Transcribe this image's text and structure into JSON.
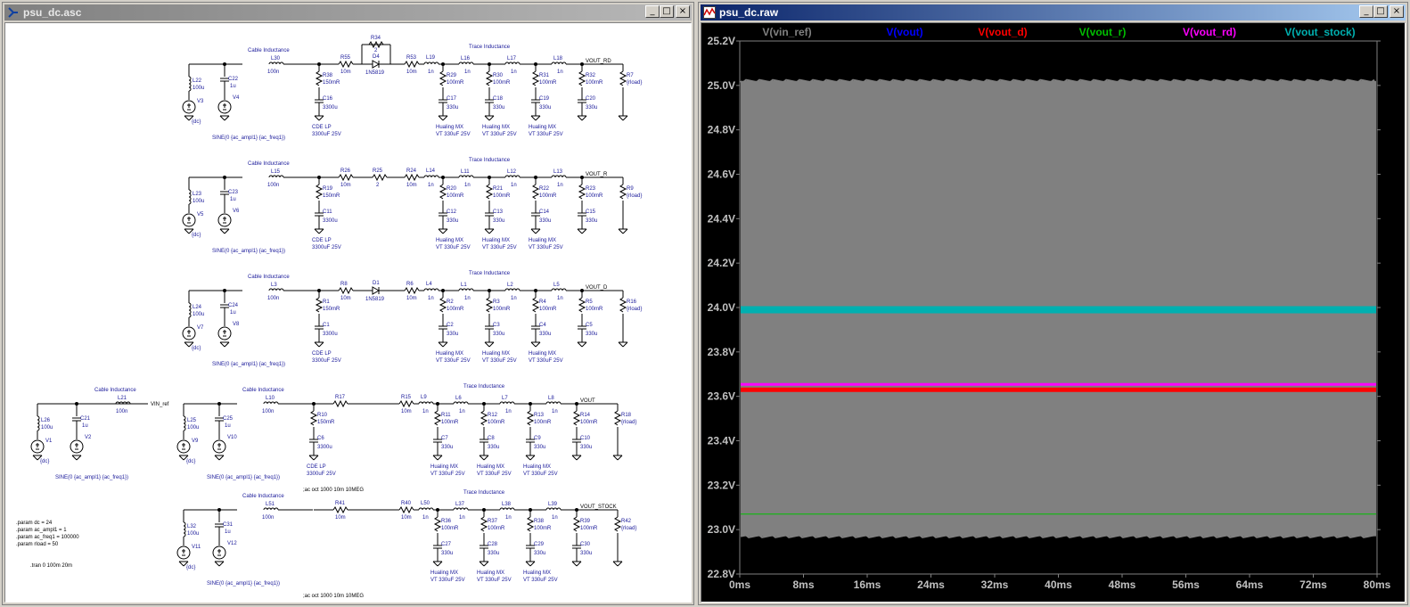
{
  "schematic_window": {
    "title": "psu_dc.asc",
    "icon": "schematic-icon",
    "buttons": {
      "minimize": "_",
      "maximize": "□",
      "close": "×"
    },
    "rows": [
      {
        "cable_label": "Cable Inductance",
        "trace_label": "Trace Inductance",
        "vout_net": "VOUT_RD",
        "parts": {
          "l_src": "L22",
          "l_src_val": "100u",
          "v_src": "V3",
          "v_src_val": "{dc}",
          "c_src": "C22",
          "c_src_val": "1u",
          "v_ac": "V4",
          "sine": "SINE(0 {ac_ampl1} {ac_freq1})",
          "l_cable": "L30",
          "l_cable_val": "100n",
          "r_bulk": "R38",
          "r_bulk_val": "150mR",
          "c_bulk": "C16",
          "c_bulk_val": "3300u",
          "bulk_note1": "CDE LP",
          "bulk_note2": "3300uF 25V",
          "r_ser": "R55",
          "r_ser_val": "10m",
          "extra_top": "R34",
          "extra_top_val": "2",
          "diode": "D4",
          "diode_val": "1N5819",
          "r_ser2": "R53",
          "r_ser2_val": "10m",
          "l_a": "L19",
          "l_a_val": "1n",
          "l_b": "L16",
          "l_b_val": "1n",
          "l_c": "L17",
          "l_c_val": "1n",
          "l_d": "L18",
          "l_d_val": "1n",
          "r1": "R29",
          "r2": "R30",
          "r3": "R31",
          "r4": "R32",
          "r_val": "100mR",
          "c1": "C17",
          "c2": "C18",
          "c3": "C19",
          "c4": "C20",
          "c_val": "330u",
          "load": "R7",
          "load_val": "{rload}",
          "cap_note1": "Hualing MX",
          "cap_note2": "VT 330uF 25V"
        }
      },
      {
        "cable_label": "Cable Inductance",
        "trace_label": "Trace Inductance",
        "vout_net": "VOUT_R",
        "parts": {
          "l_src": "L23",
          "l_src_val": "100u",
          "v_src": "V5",
          "v_src_val": "{dc}",
          "c_src": "C23",
          "c_src_val": "1u",
          "v_ac": "V6",
          "sine": "SINE(0 {ac_ampl1} {ac_freq1})",
          "l_cable": "L15",
          "l_cable_val": "100n",
          "r_bulk": "R19",
          "r_bulk_val": "150mR",
          "c_bulk": "C11",
          "c_bulk_val": "3300u",
          "bulk_note1": "CDE LP",
          "bulk_note2": "3300uF 25V",
          "r_ser": "R26",
          "r_ser_val": "10m",
          "extra_top": "R25",
          "extra_top_val": "2",
          "diode": "",
          "diode_val": "",
          "r_ser2": "R24",
          "r_ser2_val": "10m",
          "l_a": "L14",
          "l_a_val": "1n",
          "l_b": "L11",
          "l_b_val": "1n",
          "l_c": "L12",
          "l_c_val": "1n",
          "l_d": "L13",
          "l_d_val": "1n",
          "r1": "R20",
          "r2": "R21",
          "r3": "R22",
          "r4": "R23",
          "r_val": "100mR",
          "c1": "C12",
          "c2": "C13",
          "c3": "C14",
          "c4": "C15",
          "c_val": "330u",
          "load": "R9",
          "load_val": "{rload}",
          "cap_note1": "Hualing MX",
          "cap_note2": "VT 330uF 25V"
        }
      },
      {
        "cable_label": "Cable Inductance",
        "trace_label": "Trace Inductance",
        "vout_net": "VOUT_D",
        "parts": {
          "l_src": "L24",
          "l_src_val": "100u",
          "v_src": "V7",
          "v_src_val": "{dc}",
          "c_src": "C24",
          "c_src_val": "1u",
          "v_ac": "V8",
          "sine": "SINE(0 {ac_ampl1} {ac_freq1})",
          "l_cable": "L3",
          "l_cable_val": "100n",
          "r_bulk": "R1",
          "r_bulk_val": "150mR",
          "c_bulk": "C1",
          "c_bulk_val": "3300u",
          "bulk_note1": "CDE LP",
          "bulk_note2": "3300uF 25V",
          "r_ser": "R8",
          "r_ser_val": "10m",
          "extra_top": "",
          "extra_top_val": "",
          "diode": "D1",
          "diode_val": "1N5819",
          "r_ser2": "R6",
          "r_ser2_val": "10m",
          "l_a": "L4",
          "l_a_val": "1n",
          "l_b": "L1",
          "l_b_val": "1n",
          "l_c": "L2",
          "l_c_val": "1n",
          "l_d": "L5",
          "l_d_val": "1n",
          "r1": "R2",
          "r2": "R3",
          "r3": "R4",
          "r4": "R5",
          "r_val": "100mR",
          "c1": "C2",
          "c2": "C3",
          "c3": "C4",
          "c4": "C5",
          "c_val": "330u",
          "load": "R16",
          "load_val": "{rload}",
          "cap_note1": "Hualing MX",
          "cap_note2": "VT 330uF 25V"
        }
      },
      {
        "cable_label": "Cable Inductance",
        "trace_label": "Trace Inductance",
        "vout_net": "VOUT",
        "parts": {
          "l_src": "L25",
          "l_src_val": "100u",
          "v_src": "V9",
          "v_src_val": "{dc}",
          "c_src": "C25",
          "c_src_val": "1u",
          "v_ac": "V10",
          "sine": "SINE(0 {ac_ampl1} {ac_freq1})",
          "l_cable": "L10",
          "l_cable_val": "100n",
          "r_bulk": "R10",
          "r_bulk_val": "150mR",
          "c_bulk": "C6",
          "c_bulk_val": "3300u",
          "bulk_note1": "CDE LP",
          "bulk_note2": "3300uF 25V",
          "r_ser": "R17",
          "r_ser_val": "",
          "extra_top": "",
          "extra_top_val": "",
          "diode": "",
          "diode_val": "",
          "r_ser2": "R15",
          "r_ser2_val": "10m",
          "l_a": "L9",
          "l_a_val": "1n",
          "l_b": "L6",
          "l_b_val": "1n",
          "l_c": "L7",
          "l_c_val": "1n",
          "l_d": "L8",
          "l_d_val": "1n",
          "r1": "R11",
          "r2": "R12",
          "r3": "R13",
          "r4": "R14",
          "r_val": "100mR",
          "c1": "C7",
          "c2": "C8",
          "c3": "C9",
          "c4": "C10",
          "c_val": "330u",
          "load": "R18",
          "load_val": "{rload}",
          "cap_note1": "Hualing MX",
          "cap_note2": "VT 330uF 25V"
        },
        "ac_directive": ";ac oct 1000 10m 10MEG"
      },
      {
        "cable_label": "Cable Inductance",
        "trace_label": "Trace Inductance",
        "vout_net": "VOUT_STOCK",
        "parts": {
          "l_src": "L32",
          "l_src_val": "100u",
          "v_src": "V11",
          "v_src_val": "{dc}",
          "c_src": "C31",
          "c_src_val": "1u",
          "v_ac": "V12",
          "sine": "SINE(0 {ac_ampl1} {ac_freq1})",
          "l_cable": "L51",
          "l_cable_val": "100n",
          "r_bulk": "",
          "r_bulk_val": "",
          "c_bulk": "",
          "c_bulk_val": "",
          "bulk_note1": "",
          "bulk_note2": "",
          "r_ser": "R41",
          "r_ser_val": "10m",
          "extra_top": "",
          "extra_top_val": "",
          "diode": "",
          "diode_val": "",
          "r_ser2": "R40",
          "r_ser2_val": "10m",
          "l_a": "L50",
          "l_a_val": "1n",
          "l_b": "L37",
          "l_b_val": "1n",
          "l_c": "L38",
          "l_c_val": "1n",
          "l_d": "L39",
          "l_d_val": "1n",
          "r1": "R36",
          "r2": "R37",
          "r3": "R38",
          "r4": "R39",
          "r_val": "100mR",
          "c1": "C27",
          "c2": "C28",
          "c3": "C29",
          "c4": "C30",
          "c_val": "330u",
          "load": "R42",
          "load_val": "{rload}",
          "cap_note1": "Hualing MX",
          "cap_note2": "VT 330uF 25V"
        },
        "ac_directive": ";ac oct 1000 10m 10MEG"
      }
    ],
    "ref_circuit": {
      "cable_label": "Cable Inductance",
      "l_src": "L26",
      "l_src_val": "100u",
      "v_src": "V1",
      "v_src_val": "{dc}",
      "c_src": "C21",
      "c_src_val": "1u",
      "v_ac": "V2",
      "sine": "SINE(0 {ac_ampl1} {ac_freq1})",
      "l_cable": "L21",
      "l_cable_val": "100n",
      "net": "VIN_ref"
    },
    "directives": [
      ".param dc = 24",
      ".param ac_ampl1 = 1",
      ".param ac_freq1 = 100000",
      ".param rload = 50"
    ],
    "tran": ".tran 0 100m 20m"
  },
  "waveform_window": {
    "title": "psu_dc.raw",
    "icon": "waveform-icon",
    "buttons": {
      "minimize": "_",
      "maximize": "□",
      "close": "×"
    },
    "chart_data": {
      "type": "line",
      "title": "",
      "xlabel": "",
      "ylabel": "",
      "xlim": [
        0,
        80
      ],
      "ylim": [
        22.8,
        25.2
      ],
      "x_unit": "ms",
      "y_unit": "V",
      "x_ticks": [
        "0ms",
        "8ms",
        "16ms",
        "24ms",
        "32ms",
        "40ms",
        "48ms",
        "56ms",
        "64ms",
        "72ms",
        "80ms"
      ],
      "y_ticks": [
        "25.2V",
        "25.0V",
        "24.8V",
        "24.6V",
        "24.4V",
        "24.2V",
        "24.0V",
        "23.8V",
        "23.6V",
        "23.4V",
        "23.2V",
        "23.0V",
        "22.8V"
      ],
      "grid": false,
      "legend_position": "top",
      "series": [
        {
          "name": "V(vin_ref)",
          "color": "#808080",
          "kind": "band",
          "low": 22.97,
          "high": 25.02
        },
        {
          "name": "V(vout)",
          "color": "#0000ff",
          "kind": "line",
          "value": 23.63
        },
        {
          "name": "V(vout_d)",
          "color": "#ff0000",
          "kind": "line",
          "value": 23.63
        },
        {
          "name": "V(vout_r)",
          "color": "#00c000",
          "kind": "line",
          "value": 23.07
        },
        {
          "name": "V(vout_rd)",
          "color": "#ff00ff",
          "kind": "line",
          "value": 23.65
        },
        {
          "name": "V(vout_stock)",
          "color": "#00b0b0",
          "kind": "line",
          "value": 23.99
        }
      ]
    }
  }
}
